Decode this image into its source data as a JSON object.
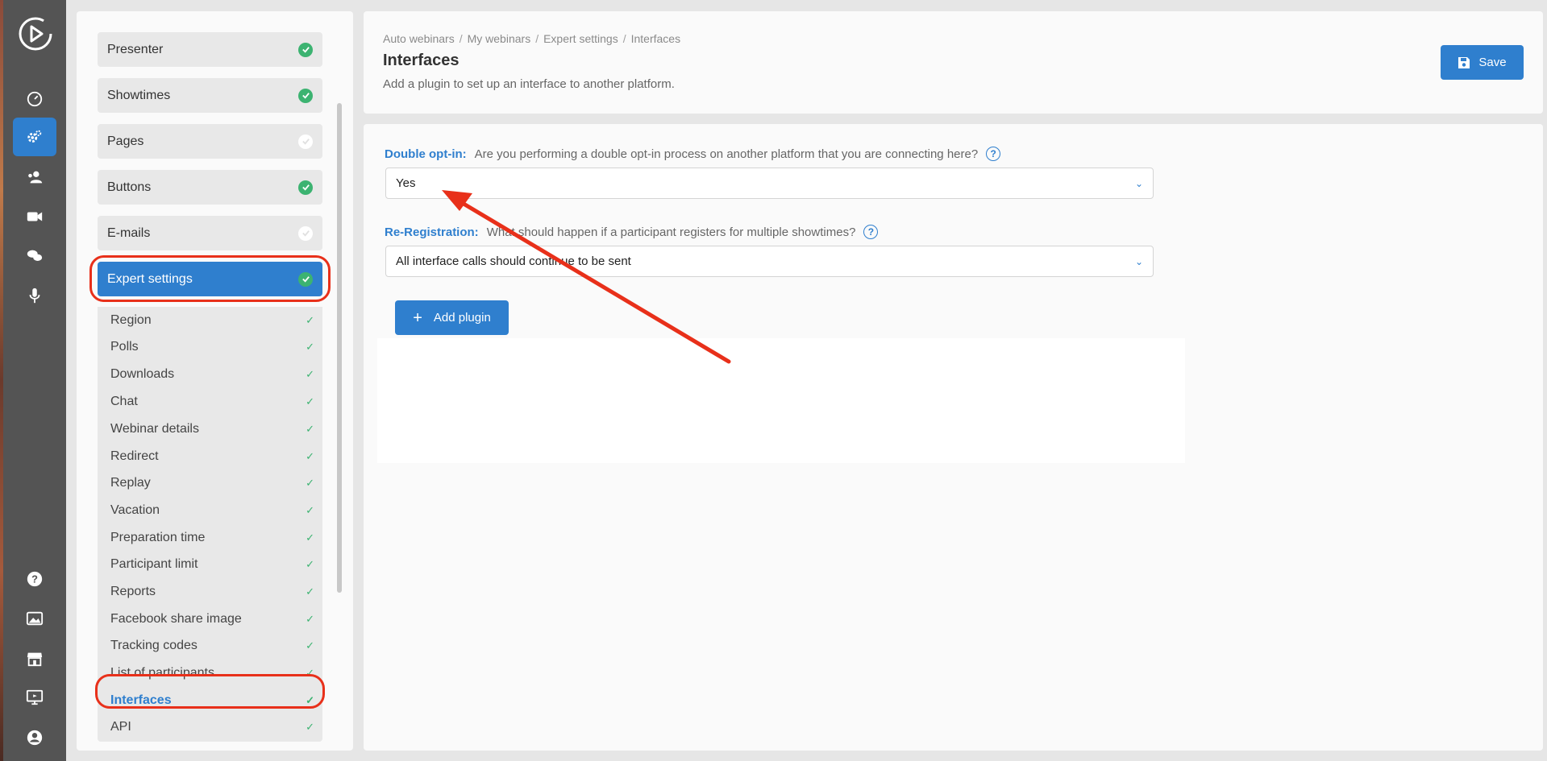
{
  "header": {
    "breadcrumb": [
      "Auto webinars",
      "My webinars",
      "Expert settings",
      "Interfaces"
    ],
    "title": "Interfaces",
    "subtitle": "Add a plugin to set up an interface to another platform.",
    "save_label": "Save"
  },
  "sidebar": {
    "items": [
      {
        "label": "Presenter",
        "status": "done"
      },
      {
        "label": "Showtimes",
        "status": "done"
      },
      {
        "label": "Pages",
        "status": "pending"
      },
      {
        "label": "Buttons",
        "status": "done"
      },
      {
        "label": "E-mails",
        "status": "pending"
      },
      {
        "label": "Expert settings",
        "status": "done"
      }
    ],
    "subitems": [
      "Region",
      "Polls",
      "Downloads",
      "Chat",
      "Webinar details",
      "Redirect",
      "Replay",
      "Vacation",
      "Preparation time",
      "Participant limit",
      "Reports",
      "Facebook share image",
      "Tracking codes",
      "List of participants",
      "Interfaces",
      "API"
    ]
  },
  "form": {
    "double_optin": {
      "key": "Double opt-in:",
      "question": "Are you performing a double opt-in process on another platform that you are connecting here?",
      "value": "Yes"
    },
    "reregistration": {
      "key": "Re-Registration:",
      "question": "What should happen if a participant registers for multiple showtimes?",
      "value": "All interface calls should continue to be sent"
    },
    "add_plugin_label": "Add plugin"
  },
  "rail": {
    "icons": [
      "dashboard-icon",
      "settings-icon",
      "users-icon",
      "video-icon",
      "chat-icon",
      "microphone-icon",
      "help-icon",
      "image-icon",
      "store-icon",
      "monitor-icon",
      "account-icon"
    ]
  },
  "colors": {
    "accent": "#2f7fce",
    "success": "#3cb371",
    "annotation": "#e8301a"
  }
}
